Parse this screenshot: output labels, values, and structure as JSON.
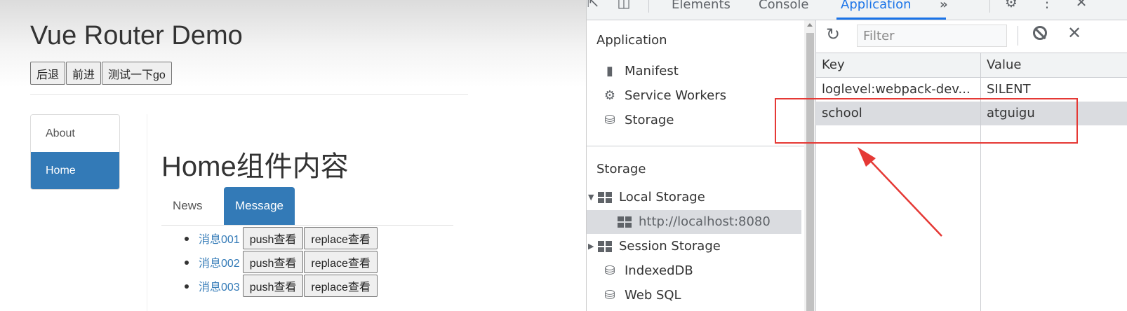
{
  "app": {
    "title": "Vue Router Demo",
    "nav_buttons": [
      "后退",
      "前进",
      "测试一下go"
    ],
    "sidenav": [
      {
        "label": "About",
        "active": false
      },
      {
        "label": "Home",
        "active": true
      }
    ],
    "home_title": "Home组件内容",
    "tabs": [
      {
        "label": "News",
        "active": false
      },
      {
        "label": "Message",
        "active": true
      }
    ],
    "messages": [
      {
        "label": "消息001",
        "push": "push查看",
        "replace": "replace查看"
      },
      {
        "label": "消息002",
        "push": "push查看",
        "replace": "replace查看"
      },
      {
        "label": "消息003",
        "push": "push查看",
        "replace": "replace查看"
      }
    ]
  },
  "devtools": {
    "tabs": [
      "Elements",
      "Console",
      "Application"
    ],
    "active_tab": "Application",
    "more": "»",
    "sidebar": {
      "application_header": "Application",
      "application_items": [
        "Manifest",
        "Service Workers",
        "Storage"
      ],
      "storage_header": "Storage",
      "local_storage": "Local Storage",
      "local_storage_origin": "http://localhost:8080",
      "session_storage": "Session Storage",
      "indexeddb": "IndexedDB",
      "websql": "Web SQL"
    },
    "filter_placeholder": "Filter",
    "table": {
      "headers": [
        "Key",
        "Value"
      ],
      "rows": [
        {
          "key": "loglevel:webpack-dev...",
          "value": "SILENT"
        },
        {
          "key": "school",
          "value": "atguigu",
          "selected": true
        }
      ]
    },
    "accent": "#1a73e8"
  },
  "annotation_color": "#e53935"
}
